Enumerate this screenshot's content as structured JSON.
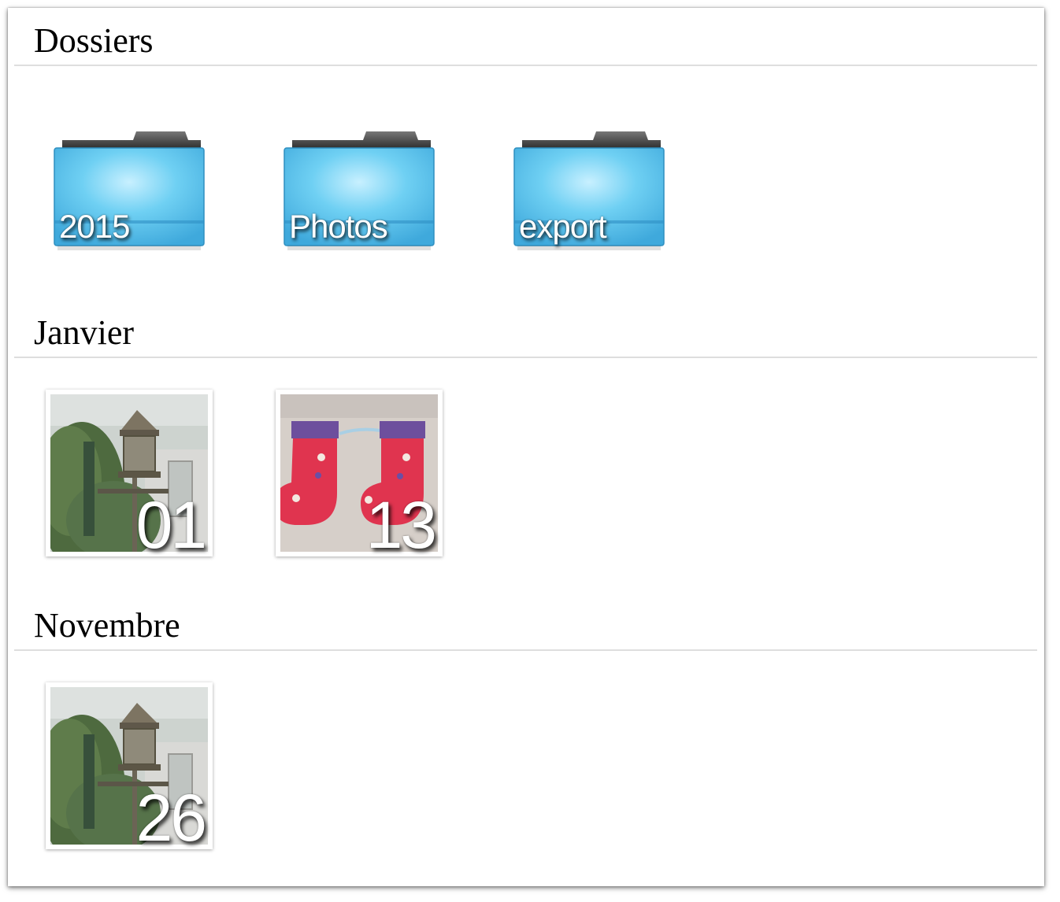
{
  "sections": {
    "folders": {
      "title": "Dossiers",
      "items": [
        {
          "label": "2015"
        },
        {
          "label": "Photos"
        },
        {
          "label": "export"
        }
      ]
    },
    "janvier": {
      "title": "Janvier",
      "items": [
        {
          "day": "01",
          "image": "bird-feeder-photo"
        },
        {
          "day": "13",
          "image": "christmas-stockings-photo"
        }
      ]
    },
    "novembre": {
      "title": "Novembre",
      "items": [
        {
          "day": "26",
          "image": "bird-feeder-photo"
        }
      ]
    }
  },
  "colors": {
    "folder_blue": "#5ec3ea",
    "folder_tab": "#3a3a3a",
    "divider": "#dedede"
  }
}
